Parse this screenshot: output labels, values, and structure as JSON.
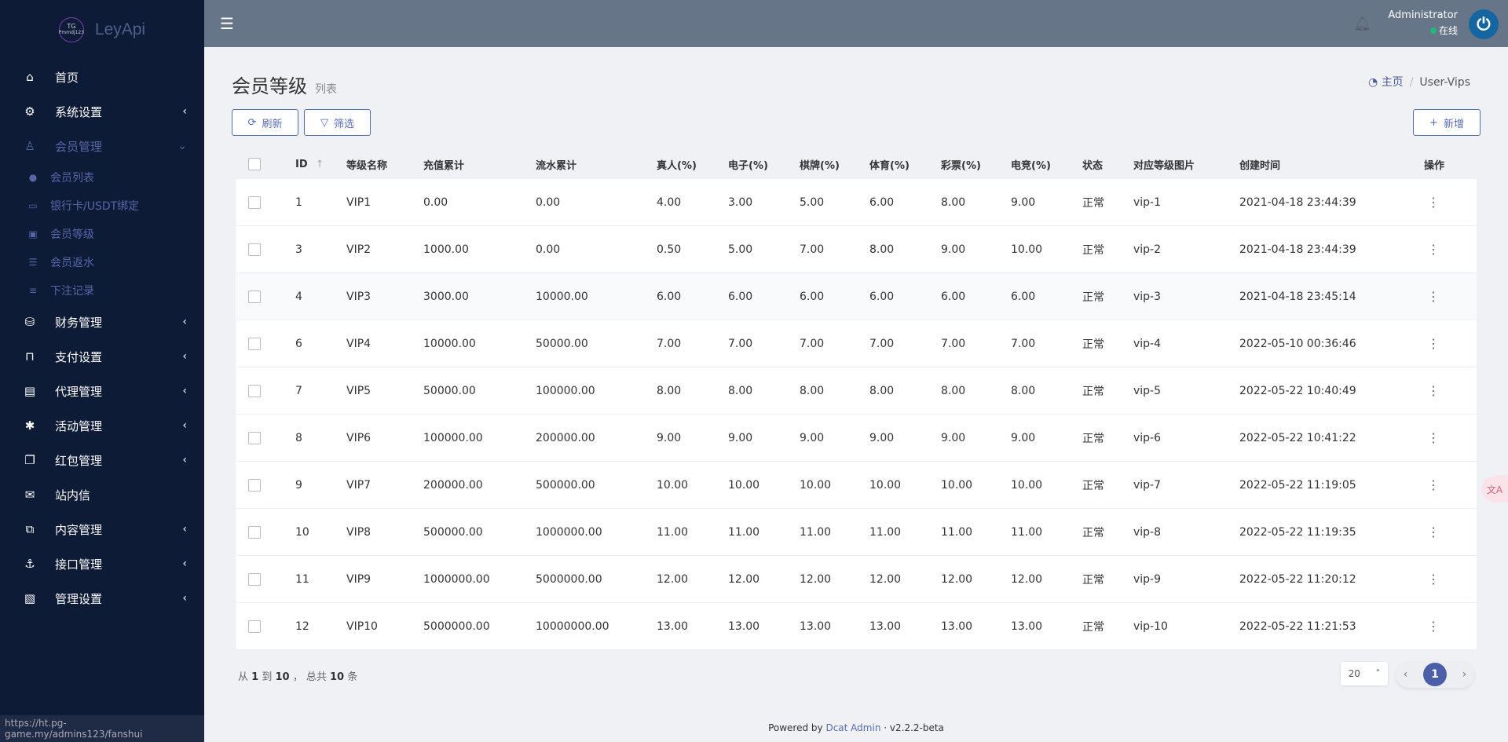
{
  "brand": {
    "logo_text": "TG",
    "logo_sub": "Pmmdj123",
    "name": "LeyApi"
  },
  "sidebar": {
    "items": [
      {
        "label": "首页",
        "icon": "home-icon",
        "glyph": "⌂"
      },
      {
        "label": "系统设置",
        "icon": "cogs-icon",
        "glyph": "⚙",
        "chev": "‹"
      },
      {
        "label": "会员管理",
        "icon": "user-icon",
        "glyph": "♙",
        "chev": "⌄",
        "open": true,
        "children": [
          {
            "label": "会员列表",
            "icon": "user-solid-icon",
            "glyph": "●"
          },
          {
            "label": "银行卡/USDT绑定",
            "icon": "credit-card-icon",
            "glyph": "▭"
          },
          {
            "label": "会员等级",
            "icon": "contact-book-icon",
            "glyph": "▣"
          },
          {
            "label": "会员返水",
            "icon": "list-icon",
            "glyph": "☰"
          },
          {
            "label": "下注记录",
            "icon": "stack-icon",
            "glyph": "≡"
          }
        ]
      },
      {
        "label": "财务管理",
        "icon": "database-icon",
        "glyph": "⛁",
        "chev": "‹"
      },
      {
        "label": "支付设置",
        "icon": "bookmark-icon",
        "glyph": "⊓",
        "chev": "‹"
      },
      {
        "label": "代理管理",
        "icon": "id-badge-icon",
        "glyph": "▤",
        "chev": "‹"
      },
      {
        "label": "活动管理",
        "icon": "yelp-icon",
        "glyph": "✱",
        "chev": "‹"
      },
      {
        "label": "红包管理",
        "icon": "clone-icon",
        "glyph": "❐",
        "chev": "‹"
      },
      {
        "label": "站内信",
        "icon": "envelope-icon",
        "glyph": "✉"
      },
      {
        "label": "内容管理",
        "icon": "copy-icon",
        "glyph": "⧉",
        "chev": "‹"
      },
      {
        "label": "接口管理",
        "icon": "anchor-icon",
        "glyph": "⚓",
        "chev": "‹"
      },
      {
        "label": "管理设置",
        "icon": "address-card-icon",
        "glyph": "▧",
        "chev": "‹"
      }
    ]
  },
  "status_url": "https://ht.pg-game.my/admins123/fanshui",
  "topbar": {
    "user": "Administrator",
    "status": "在线",
    "status_color": "#21b978"
  },
  "page": {
    "title": "会员等级",
    "subtitle": "列表",
    "breadcrumb": {
      "home": "主页",
      "current": "User-Vips"
    }
  },
  "toolbar": {
    "refresh": "刷新",
    "filter": "筛选",
    "create": "新增"
  },
  "table": {
    "columns": [
      "ID",
      "等级名称",
      "充值累计",
      "流水累计",
      "真人(%)",
      "电子(%)",
      "棋牌(%)",
      "体育(%)",
      "彩票(%)",
      "电竞(%)",
      "状态",
      "对应等级图片",
      "创建时间",
      "操作"
    ],
    "rows": [
      [
        "1",
        "VIP1",
        "0.00",
        "0.00",
        "4.00",
        "3.00",
        "5.00",
        "6.00",
        "8.00",
        "9.00",
        "正常",
        "vip-1",
        "2021-04-18 23:44:39"
      ],
      [
        "3",
        "VIP2",
        "1000.00",
        "0.00",
        "0.50",
        "5.00",
        "7.00",
        "8.00",
        "9.00",
        "10.00",
        "正常",
        "vip-2",
        "2021-04-18 23:44:39"
      ],
      [
        "4",
        "VIP3",
        "3000.00",
        "10000.00",
        "6.00",
        "6.00",
        "6.00",
        "6.00",
        "6.00",
        "6.00",
        "正常",
        "vip-3",
        "2021-04-18 23:45:14"
      ],
      [
        "6",
        "VIP4",
        "10000.00",
        "50000.00",
        "7.00",
        "7.00",
        "7.00",
        "7.00",
        "7.00",
        "7.00",
        "正常",
        "vip-4",
        "2022-05-10 00:36:46"
      ],
      [
        "7",
        "VIP5",
        "50000.00",
        "100000.00",
        "8.00",
        "8.00",
        "8.00",
        "8.00",
        "8.00",
        "8.00",
        "正常",
        "vip-5",
        "2022-05-22 10:40:49"
      ],
      [
        "8",
        "VIP6",
        "100000.00",
        "200000.00",
        "9.00",
        "9.00",
        "9.00",
        "9.00",
        "9.00",
        "9.00",
        "正常",
        "vip-6",
        "2022-05-22 10:41:22"
      ],
      [
        "9",
        "VIP7",
        "200000.00",
        "500000.00",
        "10.00",
        "10.00",
        "10.00",
        "10.00",
        "10.00",
        "10.00",
        "正常",
        "vip-7",
        "2022-05-22 11:19:05"
      ],
      [
        "10",
        "VIP8",
        "500000.00",
        "1000000.00",
        "11.00",
        "11.00",
        "11.00",
        "11.00",
        "11.00",
        "11.00",
        "正常",
        "vip-8",
        "2022-05-22 11:19:35"
      ],
      [
        "11",
        "VIP9",
        "1000000.00",
        "5000000.00",
        "12.00",
        "12.00",
        "12.00",
        "12.00",
        "12.00",
        "12.00",
        "正常",
        "vip-9",
        "2022-05-22 11:20:12"
      ],
      [
        "12",
        "VIP10",
        "5000000.00",
        "10000000.00",
        "13.00",
        "13.00",
        "13.00",
        "13.00",
        "13.00",
        "13.00",
        "正常",
        "vip-10",
        "2022-05-22 11:21:53"
      ]
    ]
  },
  "pagination": {
    "from_label": "从",
    "from": "1",
    "to_label": "到",
    "to": "10",
    "total_label": "， 总共",
    "total": "10",
    "unit": "条",
    "per_page": "20",
    "current": "1"
  },
  "footer": {
    "powered": "Powered by",
    "link": "Dcat Admin",
    "version": "v2.2.2-beta"
  },
  "float_widget": "文A",
  "accent": "#586cb1"
}
